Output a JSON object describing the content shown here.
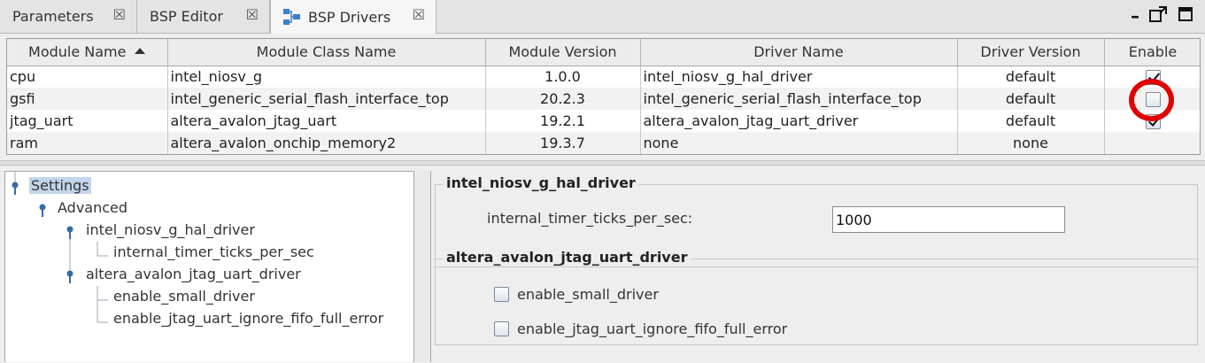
{
  "tabs": [
    {
      "label": "Parameters",
      "close": "☒"
    },
    {
      "label": "BSP Editor",
      "close": "☒"
    },
    {
      "label": "BSP Drivers",
      "close": "☒"
    }
  ],
  "window_controls": {
    "minimize": "–",
    "maximize": "max-icon"
  },
  "table": {
    "columns": [
      "Module Name",
      "Module Class Name",
      "Module Version",
      "Driver Name",
      "Driver Version",
      "Enable"
    ],
    "rows": [
      {
        "module": "cpu",
        "class": "intel_niosv_g",
        "version": "1.0.0",
        "driver": "intel_niosv_g_hal_driver",
        "driver_version": "default",
        "enable": true
      },
      {
        "module": "gsfi",
        "class": "intel_generic_serial_flash_interface_top",
        "version": "20.2.3",
        "driver": "intel_generic_serial_flash_interface_top",
        "driver_version": "default",
        "enable": false
      },
      {
        "module": "jtag_uart",
        "class": "altera_avalon_jtag_uart",
        "version": "19.2.1",
        "driver": "altera_avalon_jtag_uart_driver",
        "driver_version": "default",
        "enable": true
      },
      {
        "module": "ram",
        "class": "altera_avalon_onchip_memory2",
        "version": "19.3.7",
        "driver": "none",
        "driver_version": "none",
        "enable": null
      }
    ]
  },
  "tree": {
    "root": "Settings",
    "advanced": "Advanced",
    "driver1": "intel_niosv_g_hal_driver",
    "driver1_child": "internal_timer_ticks_per_sec",
    "driver2": "altera_avalon_jtag_uart_driver",
    "driver2_child1": "enable_small_driver",
    "driver2_child2": "enable_jtag_uart_ignore_fifo_full_error"
  },
  "settings": {
    "group1_title": "intel_niosv_g_hal_driver",
    "ticks_label": "internal_timer_ticks_per_sec:",
    "ticks_value": "1000",
    "group2_title": "altera_avalon_jtag_uart_driver",
    "small_driver_label": "enable_small_driver",
    "small_driver_checked": false,
    "ignore_fifo_label": "enable_jtag_uart_ignore_fifo_full_error",
    "ignore_fifo_checked": false
  },
  "colors": {
    "highlight_circle": "#e00000",
    "selection": "#c3d5ea"
  }
}
